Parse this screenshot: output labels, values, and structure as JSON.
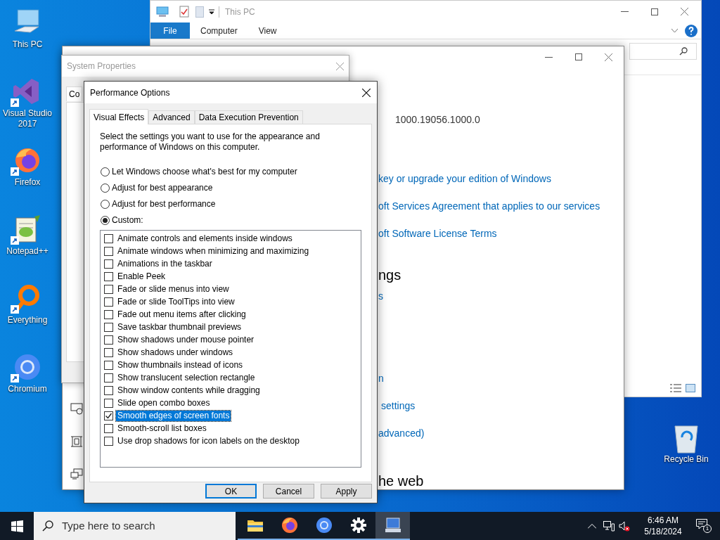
{
  "desktop_icons": [
    {
      "label": "This PC",
      "kind": "pc",
      "shortcut": false
    },
    {
      "label": "Visual Studio 2017",
      "kind": "vs",
      "shortcut": true
    },
    {
      "label": "Firefox",
      "kind": "firefox",
      "shortcut": true
    },
    {
      "label": "Notepad++",
      "kind": "notepad",
      "shortcut": true
    },
    {
      "label": "Everything",
      "kind": "everything",
      "shortcut": true
    },
    {
      "label": "Chromium",
      "kind": "chromium",
      "shortcut": true
    }
  ],
  "recycle_bin": {
    "label": "Recycle Bin"
  },
  "explorer": {
    "title": "This PC",
    "tabs": [
      {
        "label": "File",
        "selected": true
      },
      {
        "label": "Computer",
        "selected": false
      },
      {
        "label": "View",
        "selected": false
      }
    ]
  },
  "settings_window": {
    "items": [
      {
        "kind": "value",
        "text": "1000.19056.1000.0"
      },
      {
        "kind": "link",
        "text": "key or upgrade your edition of Windows"
      },
      {
        "kind": "link",
        "text": "oft Services Agreement that applies to our services"
      },
      {
        "kind": "link",
        "text": "oft Software License Terms"
      },
      {
        "kind": "heading",
        "text": "ngs"
      },
      {
        "kind": "link",
        "text": "s"
      },
      {
        "kind": "link",
        "text": "n"
      },
      {
        "kind": "link",
        "text": "settings"
      },
      {
        "kind": "link",
        "text": "advanced)"
      },
      {
        "kind": "heading",
        "text": "he web"
      }
    ]
  },
  "system_properties": {
    "title": "System Properties",
    "tab": "Co"
  },
  "performance_options": {
    "title": "Performance Options",
    "tabs": [
      {
        "label": "Visual Effects",
        "selected": true
      },
      {
        "label": "Advanced",
        "selected": false
      },
      {
        "label": "Data Execution Prevention",
        "selected": false
      }
    ],
    "description": "Select the settings you want to use for the appearance and performance of Windows on this computer.",
    "options": [
      {
        "label": "Let Windows choose what's best for my computer",
        "selected": false
      },
      {
        "label": "Adjust for best appearance",
        "selected": false
      },
      {
        "label": "Adjust for best performance",
        "selected": false
      },
      {
        "label": "Custom:",
        "selected": true
      }
    ],
    "effects": [
      {
        "label": "Animate controls and elements inside windows",
        "checked": false,
        "selected": false
      },
      {
        "label": "Animate windows when minimizing and maximizing",
        "checked": false,
        "selected": false
      },
      {
        "label": "Animations in the taskbar",
        "checked": false,
        "selected": false
      },
      {
        "label": "Enable Peek",
        "checked": false,
        "selected": false
      },
      {
        "label": "Fade or slide menus into view",
        "checked": false,
        "selected": false
      },
      {
        "label": "Fade or slide ToolTips into view",
        "checked": false,
        "selected": false
      },
      {
        "label": "Fade out menu items after clicking",
        "checked": false,
        "selected": false
      },
      {
        "label": "Save taskbar thumbnail previews",
        "checked": false,
        "selected": false
      },
      {
        "label": "Show shadows under mouse pointer",
        "checked": false,
        "selected": false
      },
      {
        "label": "Show shadows under windows",
        "checked": false,
        "selected": false
      },
      {
        "label": "Show thumbnails instead of icons",
        "checked": false,
        "selected": false
      },
      {
        "label": "Show translucent selection rectangle",
        "checked": false,
        "selected": false
      },
      {
        "label": "Show window contents while dragging",
        "checked": false,
        "selected": false
      },
      {
        "label": "Slide open combo boxes",
        "checked": false,
        "selected": false
      },
      {
        "label": "Smooth edges of screen fonts",
        "checked": true,
        "selected": true
      },
      {
        "label": "Smooth-scroll list boxes",
        "checked": false,
        "selected": false
      },
      {
        "label": "Use drop shadows for icon labels on the desktop",
        "checked": false,
        "selected": false
      }
    ],
    "buttons": [
      "OK",
      "Cancel",
      "Apply"
    ]
  },
  "taskbar": {
    "search_placeholder": "Type here to search",
    "apps": [
      {
        "kind": "folder",
        "active": false
      },
      {
        "kind": "firefox",
        "active": false
      },
      {
        "kind": "chromium",
        "active": false
      },
      {
        "kind": "gear",
        "active": false
      },
      {
        "kind": "system",
        "active": true
      }
    ],
    "time": "6:46 AM",
    "date": "5/18/2024",
    "notifications": "1"
  }
}
